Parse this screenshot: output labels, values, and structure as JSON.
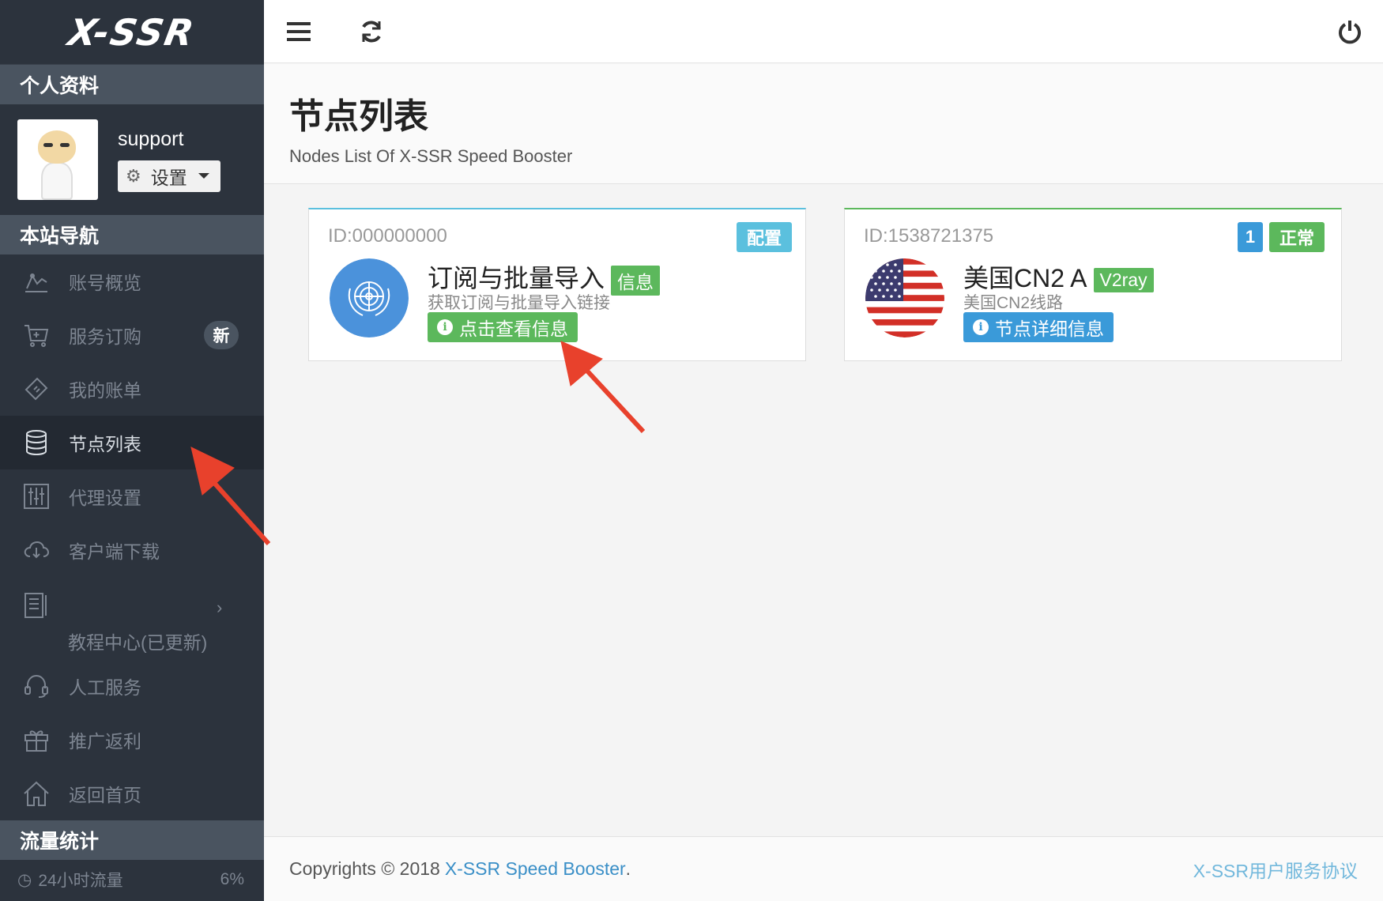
{
  "app": {
    "logo": "X-SSR"
  },
  "sidebar": {
    "profile_head": "个人资料",
    "username": "support",
    "settings_label": "设置",
    "nav_head": "本站导航",
    "items": [
      {
        "label": "账号概览",
        "icon": "chart-icon"
      },
      {
        "label": "服务订购",
        "icon": "cart-icon",
        "badge": "新"
      },
      {
        "label": "我的账单",
        "icon": "ticket-icon"
      },
      {
        "label": "节点列表",
        "icon": "database-icon",
        "active": true
      },
      {
        "label": "代理设置",
        "icon": "sliders-icon"
      },
      {
        "label": "客户端下载",
        "icon": "cloud-download-icon"
      },
      {
        "label": "教程中心(已更新)",
        "icon": "document-icon"
      },
      {
        "label": "人工服务",
        "icon": "headset-icon"
      },
      {
        "label": "推广返利",
        "icon": "gift-icon"
      },
      {
        "label": "返回首页",
        "icon": "home-icon"
      }
    ],
    "traffic_head": "流量统计",
    "traffic_label": "24小时流量",
    "traffic_pct": "6%"
  },
  "header": {
    "title": "节点列表",
    "subtitle": "Nodes List Of X-SSR Speed Booster"
  },
  "cards": [
    {
      "id": "ID:000000000",
      "badge": "配置",
      "title": "订阅与批量导入",
      "tag": "信息",
      "subtitle": "获取订阅与批量导入链接",
      "button": "点击查看信息"
    },
    {
      "id": "ID:1538721375",
      "count": "1",
      "status": "正常",
      "title": "美国CN2 A",
      "tag": "V2ray",
      "subtitle": "美国CN2线路",
      "button": "节点详细信息"
    }
  ],
  "footer": {
    "copyright": "Copyrights © 2018",
    "brand": "X-SSR Speed Booster",
    "dot": ".",
    "terms": "X-SSR用户服务协议"
  },
  "colors": {
    "sidebar": "#2c333d",
    "green": "#5cb85c",
    "blue": "#3a9ad9",
    "info": "#5bc0de",
    "arrow": "#e8412c"
  }
}
